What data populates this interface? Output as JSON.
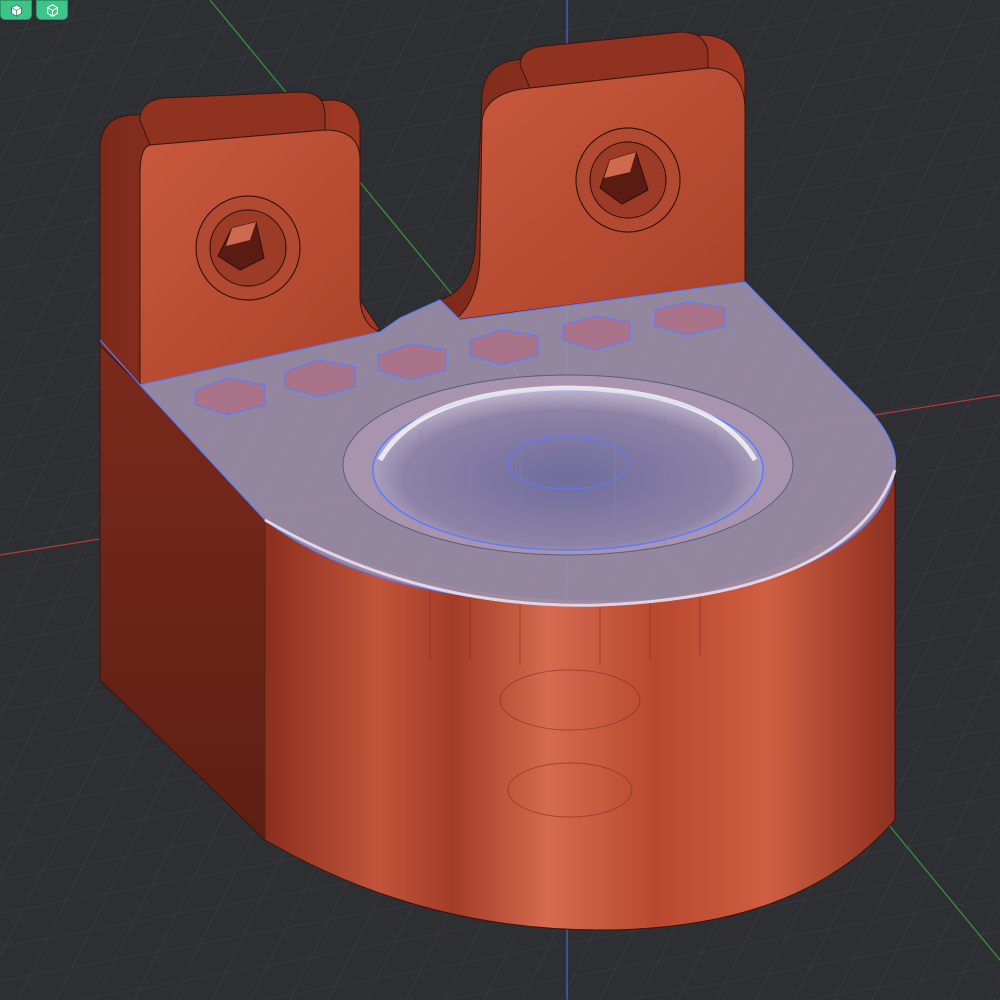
{
  "toolbar": {
    "buttons": [
      {
        "icon": "view-cube-icon"
      },
      {
        "icon": "view-cube-outline-icon"
      }
    ]
  },
  "colors": {
    "background": "#2e2f33",
    "grid": "#3d3e44",
    "axis_x": "#b23a3a",
    "axis_y": "#3a8f3a",
    "axis_z": "#4a63c8",
    "part_body": "#b4452d",
    "part_highlight": "#d86a4e",
    "part_shadow": "#6f2518",
    "selected_face": "#9c8ea8",
    "selection_edge": "#5a7cff",
    "toolbar_button": "#3cc48a"
  }
}
